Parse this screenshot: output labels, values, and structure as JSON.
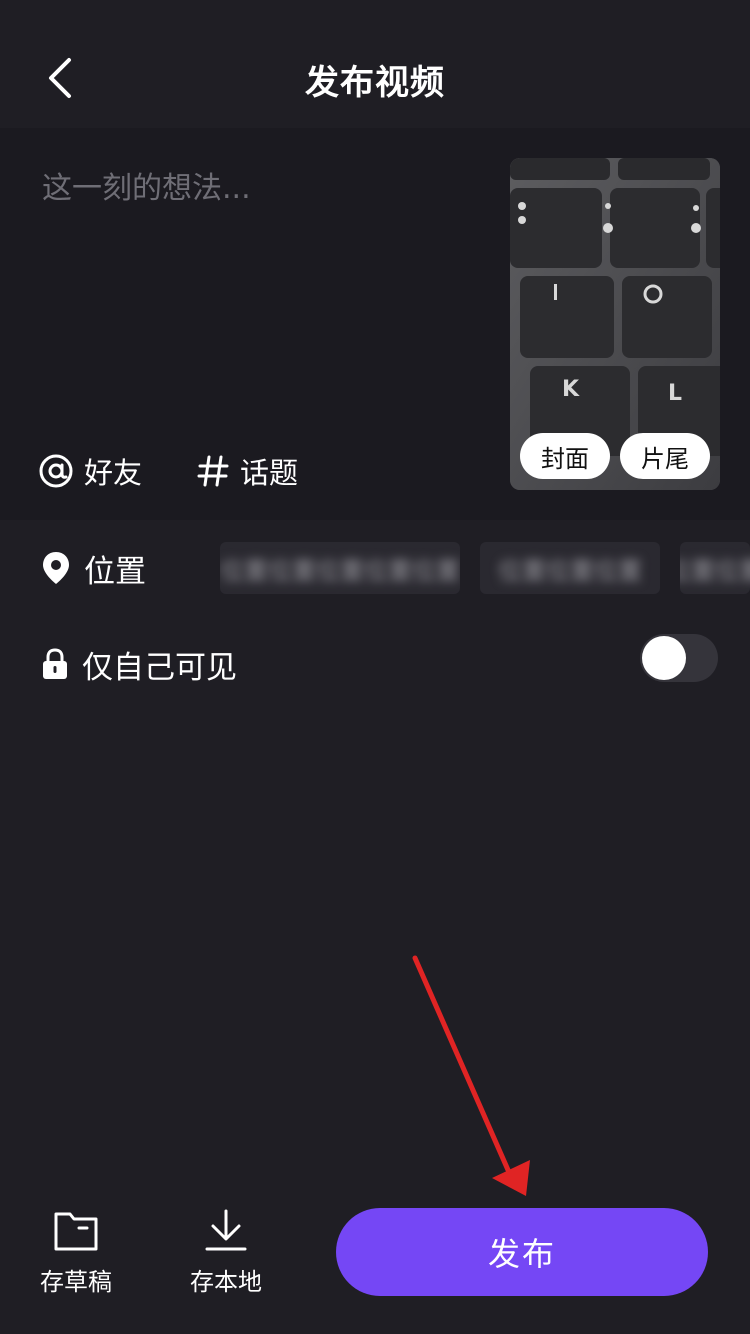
{
  "header": {
    "title": "发布视频",
    "back_icon": "chevron-left-icon"
  },
  "compose": {
    "placeholder": "这一刻的想法...",
    "mention_label": "好友",
    "topic_label": "话题",
    "cover_label": "封面",
    "ending_label": "片尾"
  },
  "location": {
    "label": "位置",
    "chips": [
      "位置位置位置位置位置",
      "位置位置位置",
      "位置位置"
    ]
  },
  "privacy": {
    "label": "仅自己可见",
    "enabled": false
  },
  "bottom": {
    "draft_label": "存草稿",
    "save_local_label": "存本地",
    "publish_label": "发布"
  },
  "colors": {
    "background": "#1f1e24",
    "accent": "#7547f5",
    "annotation": "#e02424"
  }
}
